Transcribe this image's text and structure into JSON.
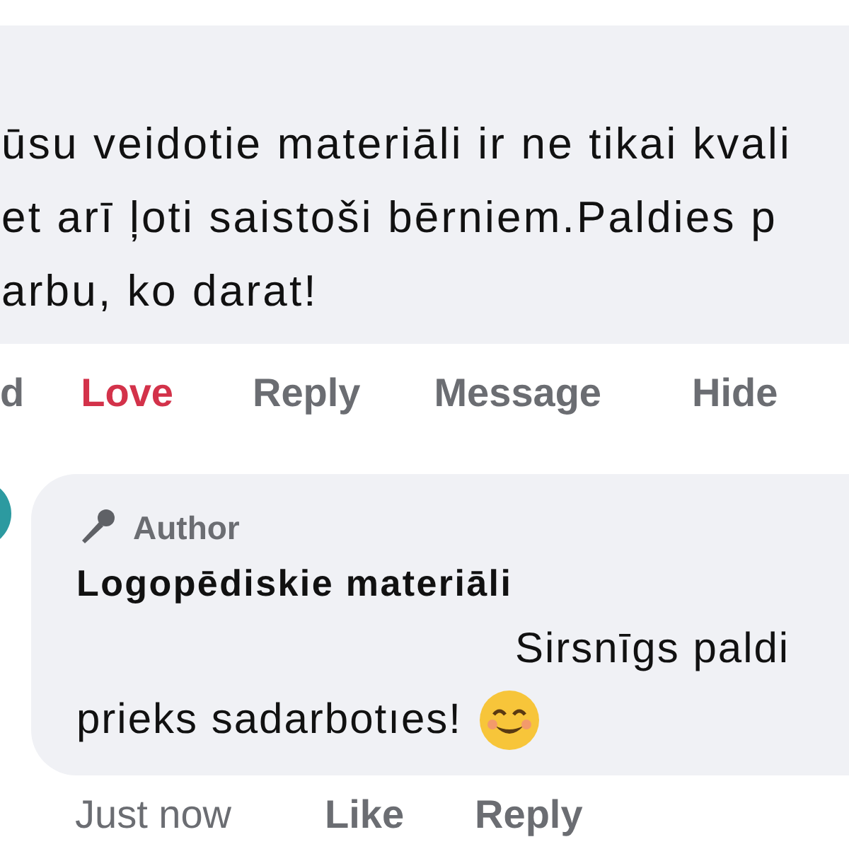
{
  "comment": {
    "text_lines": [
      "ūsu veidotie materiāli ir ne tikai kvali",
      "et arī ļoti saistoši bērniem.Paldies p",
      "arbu, ko darat!"
    ],
    "actions": [
      {
        "label": "d",
        "active": false
      },
      {
        "label": "Love",
        "active": true
      },
      {
        "label": "Reply",
        "active": false
      },
      {
        "label": "Message",
        "active": false
      },
      {
        "label": "Hide",
        "active": false
      }
    ]
  },
  "reply": {
    "badge": "Author",
    "name": "Logopēdiskie materiāli",
    "message_lines": [
      "Sirsnīgs paldi",
      "prieks sadarbotıes!"
    ],
    "actions": [
      {
        "label": "Just now",
        "kind": "time"
      },
      {
        "label": "Like",
        "kind": "action"
      },
      {
        "label": "Reply",
        "kind": "action"
      }
    ]
  }
}
